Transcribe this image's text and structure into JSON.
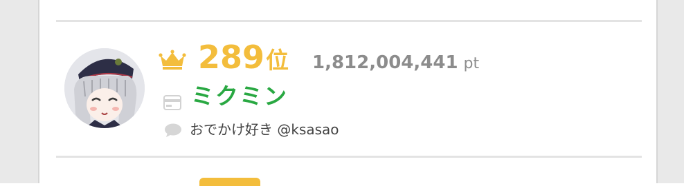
{
  "previous_entry": {
    "text_fragment": ""
  },
  "entry": {
    "rank": "289",
    "rank_suffix": "位",
    "points": "1,812,004,441",
    "points_unit": "pt",
    "username": "ミクミン",
    "bio": "おでかけ好き @ksasao"
  },
  "icons": {
    "rank_icon": "crown-icon",
    "username_icon": "card-icon",
    "bio_icon": "speech-bubble-icon"
  },
  "colors": {
    "rank": "#f3bd3c",
    "username": "#29a842",
    "points": "#8c8c8c",
    "divider": "#e3e3e3"
  }
}
